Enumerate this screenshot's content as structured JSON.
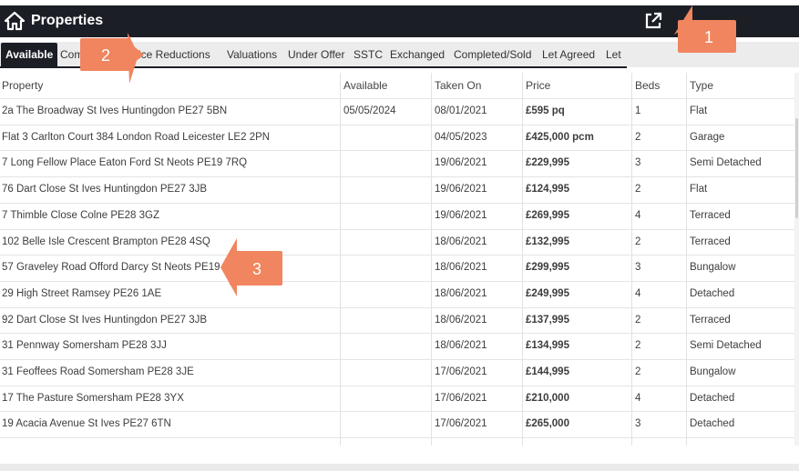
{
  "header": {
    "title": "Properties",
    "home_icon": "home-icon",
    "external_icon": "external-link-icon"
  },
  "tabs": [
    {
      "label": "Available",
      "active": true
    },
    {
      "label": "Com"
    },
    {
      "label": "rice Reductions"
    },
    {
      "label": "Valuations"
    },
    {
      "label": "Under Offer"
    },
    {
      "label": "SSTC"
    },
    {
      "label": "Exchanged"
    },
    {
      "label": "Completed/Sold"
    },
    {
      "label": "Let Agreed"
    },
    {
      "label": "Let"
    }
  ],
  "table": {
    "columns": [
      "Property",
      "Available",
      "Taken On",
      "Price",
      "Beds",
      "Type"
    ],
    "rows": [
      {
        "property": "2a The Broadway St Ives Huntingdon PE27 5BN",
        "available": "05/05/2024",
        "taken_on": "08/01/2021",
        "price": "£595 pq",
        "beds": "1",
        "type": "Flat"
      },
      {
        "property": "Flat 3 Carlton Court 384 London Road Leicester LE2 2PN",
        "available": "",
        "taken_on": "04/05/2023",
        "price": "£425,000 pcm",
        "beds": "2",
        "type": "Garage"
      },
      {
        "property": "7 Long Fellow Place Eaton Ford St Neots PE19 7RQ",
        "available": "",
        "taken_on": "19/06/2021",
        "price": "£229,995",
        "beds": "3",
        "type": "Semi Detached"
      },
      {
        "property": "76 Dart Close St Ives Huntingdon PE27 3JB",
        "available": "",
        "taken_on": "19/06/2021",
        "price": "£124,995",
        "beds": "2",
        "type": "Flat"
      },
      {
        "property": "7 Thimble Close Colne PE28 3GZ",
        "available": "",
        "taken_on": "19/06/2021",
        "price": "£269,995",
        "beds": "4",
        "type": "Terraced"
      },
      {
        "property": "102 Belle Isle Crescent Brampton PE28 4SQ",
        "available": "",
        "taken_on": "18/06/2021",
        "price": "£132,995",
        "beds": "2",
        "type": "Terraced"
      },
      {
        "property": "57 Graveley Road Offord Darcy St Neots PE19 5",
        "available": "",
        "taken_on": "18/06/2021",
        "price": "£299,995",
        "beds": "3",
        "type": "Bungalow"
      },
      {
        "property": "29 High Street Ramsey PE26 1AE",
        "available": "",
        "taken_on": "18/06/2021",
        "price": "£249,995",
        "beds": "4",
        "type": "Detached"
      },
      {
        "property": "92 Dart Close St Ives Huntingdon PE27 3JB",
        "available": "",
        "taken_on": "18/06/2021",
        "price": "£137,995",
        "beds": "2",
        "type": "Terraced"
      },
      {
        "property": "31 Pennway Somersham PE28 3JJ",
        "available": "",
        "taken_on": "18/06/2021",
        "price": "£134,995",
        "beds": "2",
        "type": "Semi Detached"
      },
      {
        "property": "31 Feoffees Road Somersham PE28 3JE",
        "available": "",
        "taken_on": "17/06/2021",
        "price": "£144,995",
        "beds": "2",
        "type": "Bungalow"
      },
      {
        "property": "17 The Pasture Somersham PE28 3YX",
        "available": "",
        "taken_on": "17/06/2021",
        "price": "£210,000",
        "beds": "4",
        "type": "Detached"
      },
      {
        "property": "19 Acacia Avenue St Ives PE27 6TN",
        "available": "",
        "taken_on": "17/06/2021",
        "price": "£265,000",
        "beds": "3",
        "type": "Detached"
      }
    ]
  },
  "callouts": [
    {
      "label": "1",
      "color": "#f0855f"
    },
    {
      "label": "2",
      "color": "#f0855f"
    },
    {
      "label": "3",
      "color": "#f0855f"
    }
  ]
}
